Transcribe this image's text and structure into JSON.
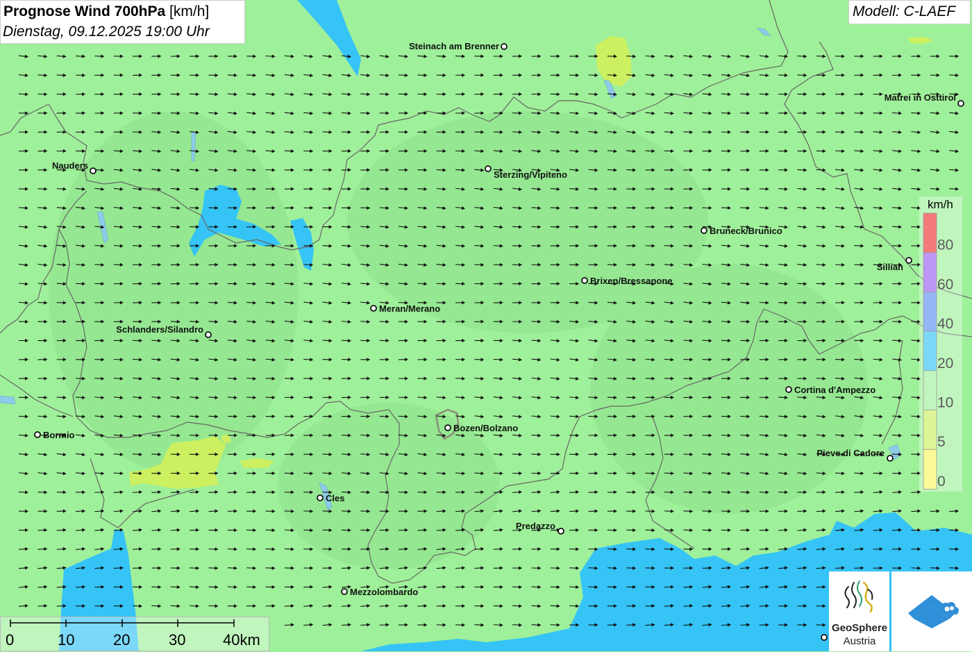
{
  "title": {
    "bold": "Prognose Wind 700hPa",
    "unit": "[km/h]",
    "datetime": "Dienstag, 09.12.2025 19:00 Uhr"
  },
  "model_label": "Modell: C-LAEF",
  "legend": {
    "unit": "km/h",
    "labels": [
      "80",
      "60",
      "40",
      "20",
      "10",
      "5",
      "0"
    ],
    "bins": [
      {
        "color": "#ee3333"
      },
      {
        "color": "#9b5ff0"
      },
      {
        "color": "#5b8ff0"
      },
      {
        "color": "#35c4f5"
      },
      {
        "color": "#9ff09a"
      },
      {
        "color": "#cdf060"
      },
      {
        "color": "#f7f75e"
      }
    ]
  },
  "scale_bar": {
    "labels": [
      "0",
      "10",
      "20",
      "30",
      "40km"
    ]
  },
  "places": [
    {
      "name": "Steinach am Brenner"
    },
    {
      "name": "Matrei in Osttirol"
    },
    {
      "name": "Nauders"
    },
    {
      "name": "Sterzing/Vipiteno"
    },
    {
      "name": "Bruneck/Brunico"
    },
    {
      "name": "Sillian"
    },
    {
      "name": "Brixen/Bressanone"
    },
    {
      "name": "Meran/Merano"
    },
    {
      "name": "Schlanders/Silandro"
    },
    {
      "name": "Cortina d'Ampezzo"
    },
    {
      "name": "Bormio"
    },
    {
      "name": "Bozen/Bolzano"
    },
    {
      "name": "Pieve di Cadore"
    },
    {
      "name": "Cles"
    },
    {
      "name": "Predazzo"
    },
    {
      "name": "Mezzolombardo"
    }
  ],
  "logos": {
    "geosphere_line1": "GeoSphere",
    "geosphere_line2": "Austria"
  },
  "colors": {
    "wind_10_20": "#9ff09a",
    "wind_20_40": "#35c4f5",
    "wind_5_10": "#cdf060"
  },
  "icons": [
    "wind-arrow-icon",
    "city-marker-icon",
    "geosphere-logo-icon",
    "cloud-logo-icon"
  ]
}
